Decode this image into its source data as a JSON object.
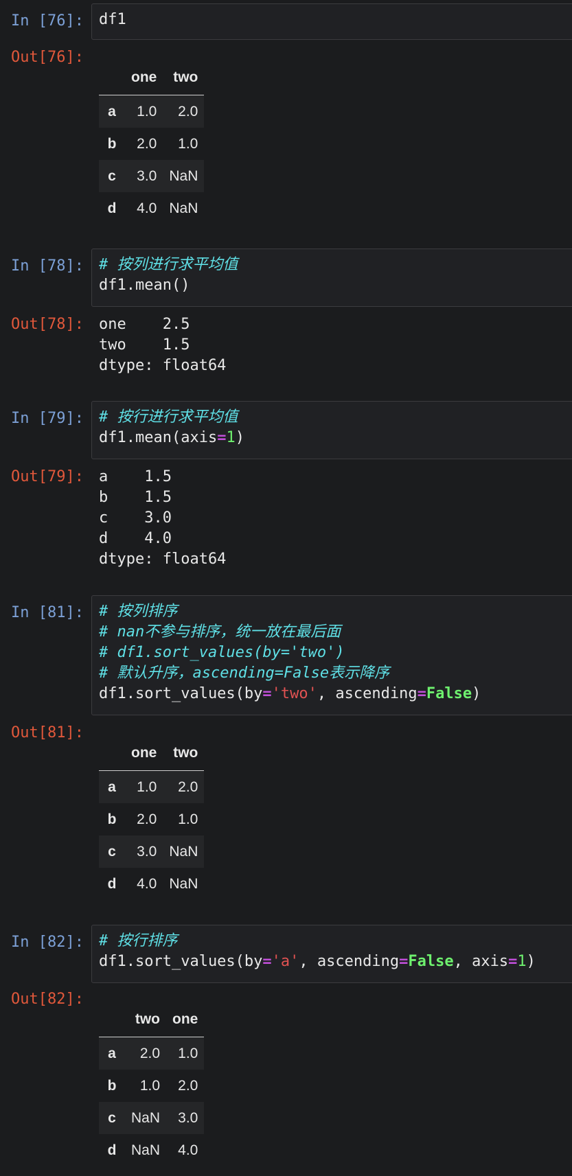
{
  "cells": [
    {
      "in_prompt": "In [76]:",
      "code": [
        "df1"
      ],
      "out_prompt": "Out[76]:",
      "table": {
        "columns": [
          "one",
          "two"
        ],
        "rows": [
          {
            "index": "a",
            "values": [
              "1.0",
              "2.0"
            ]
          },
          {
            "index": "b",
            "values": [
              "2.0",
              "1.0"
            ]
          },
          {
            "index": "c",
            "values": [
              "3.0",
              "NaN"
            ]
          },
          {
            "index": "d",
            "values": [
              "4.0",
              "NaN"
            ]
          }
        ]
      }
    },
    {
      "in_prompt": "In [78]:",
      "code": [
        "# 按列进行求平均值",
        "df1.mean()"
      ],
      "out_prompt": "Out[78]:",
      "text": [
        "one    2.5",
        "two    1.5",
        "dtype: float64"
      ]
    },
    {
      "in_prompt": "In [79]:",
      "code": [
        "# 按行进行求平均值",
        "df1.mean(axis=1)"
      ],
      "out_prompt": "Out[79]:",
      "text": [
        "a    1.5",
        "b    1.5",
        "c    3.0",
        "d    4.0",
        "dtype: float64"
      ]
    },
    {
      "in_prompt": "In [81]:",
      "code": [
        "# 按列排序",
        "# nan不参与排序，统一放在最后面",
        "# df1.sort_values(by='two')",
        "# 默认升序，ascending=False表示降序",
        "df1.sort_values(by='two', ascending=False)"
      ],
      "out_prompt": "Out[81]:",
      "table": {
        "columns": [
          "one",
          "two"
        ],
        "rows": [
          {
            "index": "a",
            "values": [
              "1.0",
              "2.0"
            ]
          },
          {
            "index": "b",
            "values": [
              "2.0",
              "1.0"
            ]
          },
          {
            "index": "c",
            "values": [
              "3.0",
              "NaN"
            ]
          },
          {
            "index": "d",
            "values": [
              "4.0",
              "NaN"
            ]
          }
        ]
      }
    },
    {
      "in_prompt": "In [82]:",
      "code": [
        "# 按行排序",
        "df1.sort_values(by='a', ascending=False, axis=1)"
      ],
      "out_prompt": "Out[82]:",
      "table": {
        "columns": [
          "two",
          "one"
        ],
        "rows": [
          {
            "index": "a",
            "values": [
              "2.0",
              "1.0"
            ]
          },
          {
            "index": "b",
            "values": [
              "1.0",
              "2.0"
            ]
          },
          {
            "index": "c",
            "values": [
              "NaN",
              "3.0"
            ]
          },
          {
            "index": "d",
            "values": [
              "NaN",
              "4.0"
            ]
          }
        ]
      }
    }
  ],
  "colors": {
    "background": "#1b1c1e",
    "in_prompt": "#7ca0d6",
    "out_prompt": "#e1583b",
    "comment": "#5fe0e6",
    "number": "#6ef06e",
    "operator": "#c04fd8",
    "string": "#e05252"
  }
}
